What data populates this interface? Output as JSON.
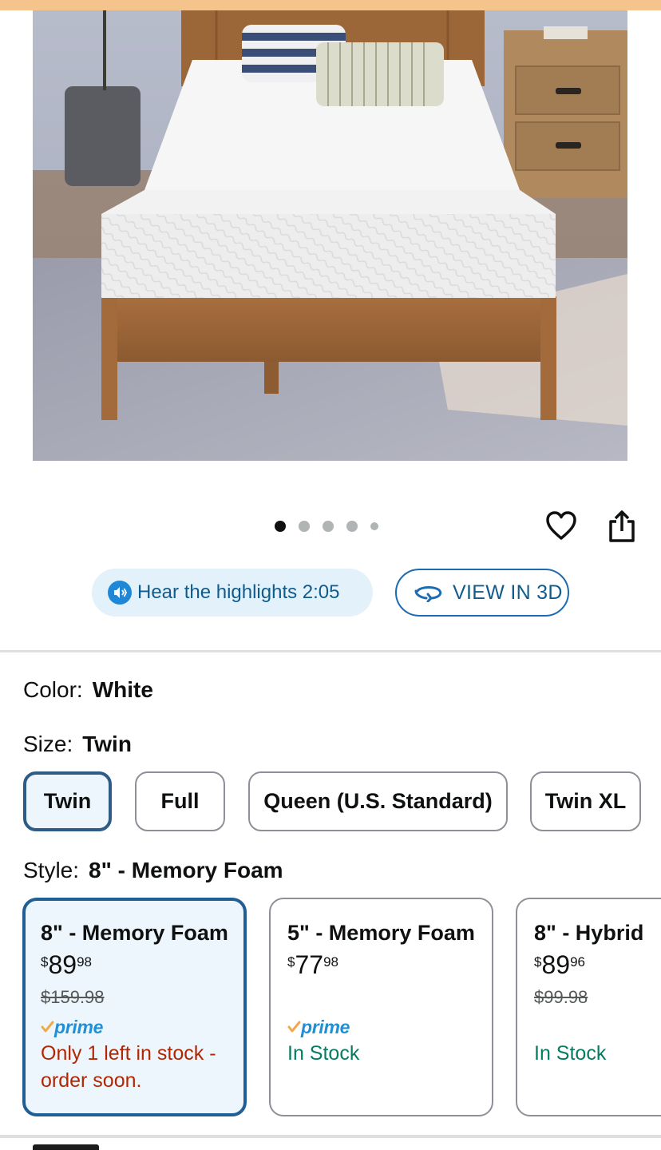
{
  "carousel": {
    "total_images": 5,
    "active_index": 0
  },
  "actions": {
    "audio_label": "Hear the highlights 2:05",
    "view3d_label": "VIEW IN 3D"
  },
  "color": {
    "label": "Color:",
    "value": "White"
  },
  "size": {
    "label": "Size:",
    "value": "Twin",
    "options": [
      "Twin",
      "Full",
      "Queen (U.S. Standard)",
      "Twin XL"
    ]
  },
  "style": {
    "label": "Style:",
    "value": "8\" - Memory Foam",
    "options": [
      {
        "title": "8\" - Memory Foam",
        "currency": "$",
        "price_whole": "89",
        "price_fraction": "98",
        "list_price": "$159.98",
        "prime": "prime",
        "stock": "Only 1 left in stock - order soon."
      },
      {
        "title": "5\" - Memory Foam",
        "currency": "$",
        "price_whole": "77",
        "price_fraction": "98",
        "list_price": "",
        "prime": "prime",
        "stock": "In Stock"
      },
      {
        "title": "8\" - Hybrid",
        "currency": "$",
        "price_whole": "89",
        "price_fraction": "96",
        "list_price": "$99.98",
        "prime": "",
        "stock": "In Stock"
      }
    ]
  },
  "colors": {
    "accent_blue": "#1f5f96",
    "low_stock": "#b12704",
    "in_stock": "#067d62",
    "prime_blue": "#1f8fd6"
  },
  "icons": [
    "audio-icon",
    "view-3d-icon",
    "heart-icon",
    "share-icon",
    "prime-check-icon"
  ]
}
